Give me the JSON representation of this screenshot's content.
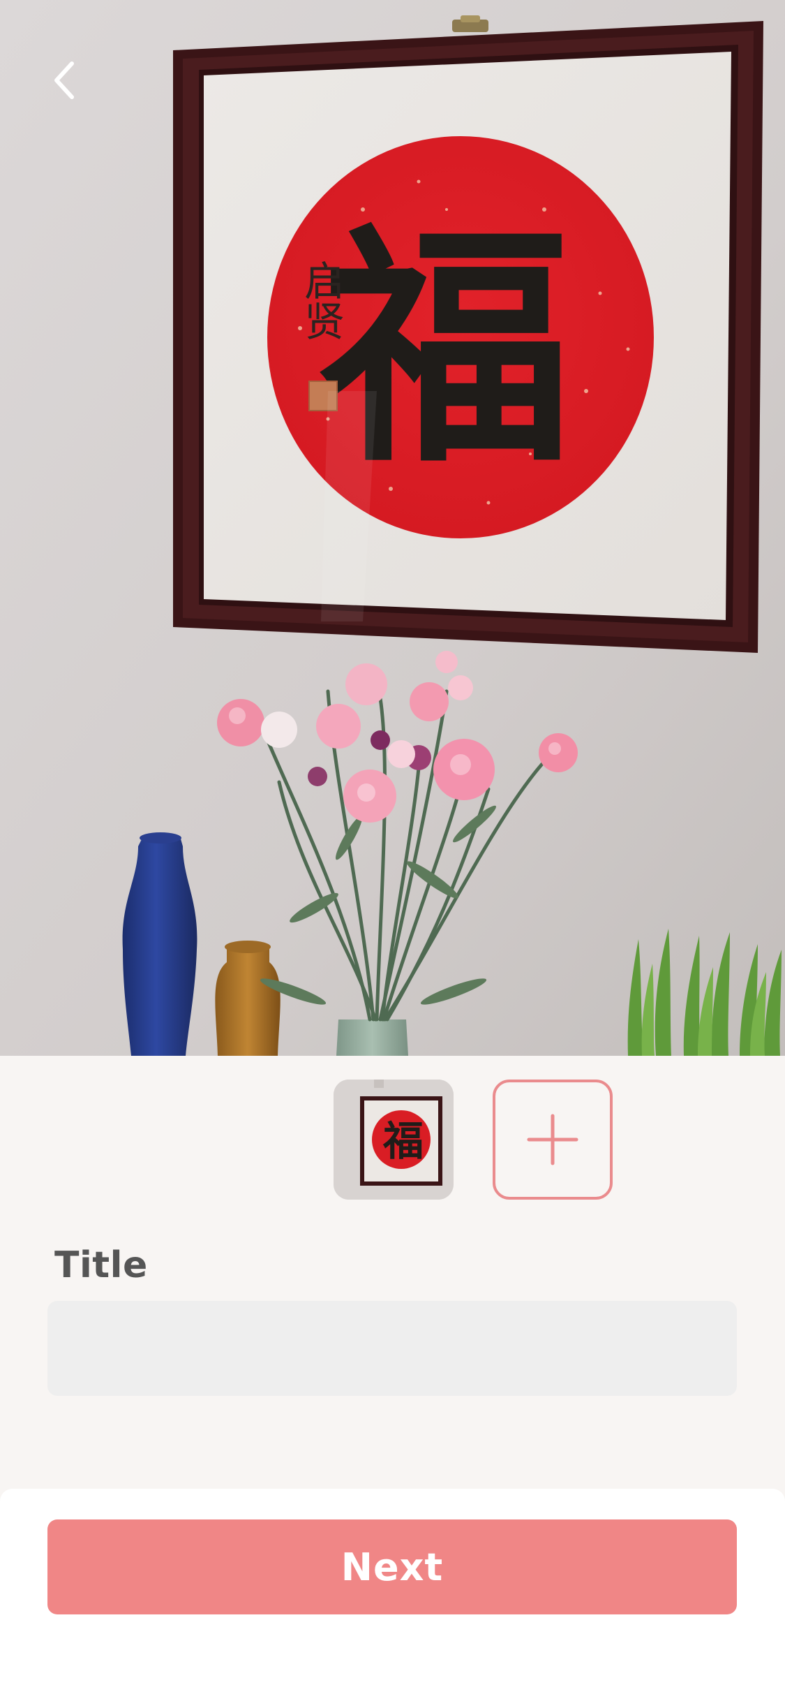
{
  "nav": {
    "back_icon": "chevron-left-icon"
  },
  "photo": {
    "calligraphy_character": "福",
    "signature_text": "启贤"
  },
  "photos_strip": {
    "add_icon": "plus-icon",
    "thumbnail_character": "福"
  },
  "form": {
    "title_label": "Title",
    "title_value": "",
    "title_placeholder": ""
  },
  "footer": {
    "next_label": "Next"
  },
  "colors": {
    "accent": "#f08686",
    "accent_border": "#ea8b8d",
    "label": "#555555",
    "input_bg": "#eeeeee",
    "background": "#f8f5f3"
  }
}
